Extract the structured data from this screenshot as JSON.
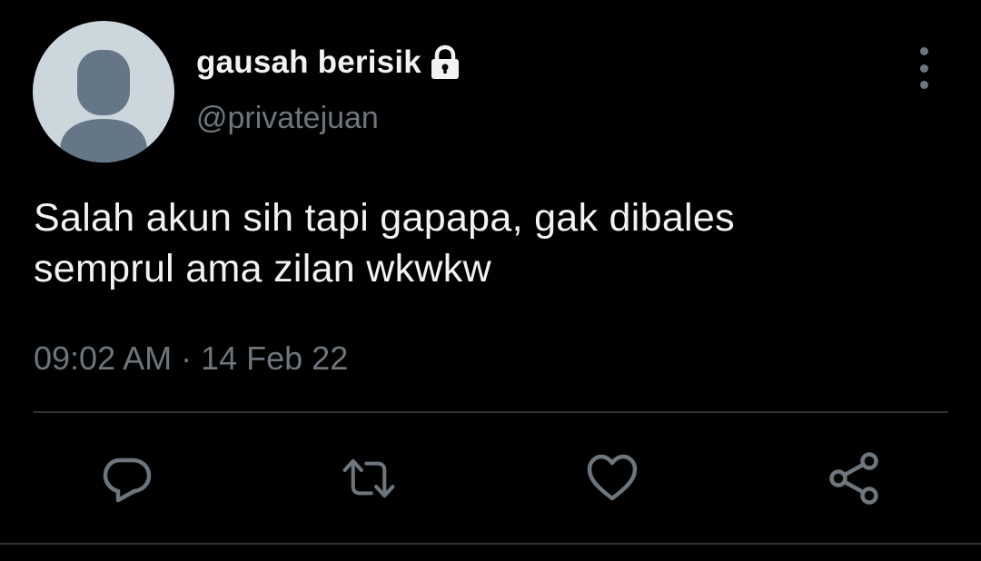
{
  "author": {
    "display_name": "gausah berisik",
    "handle": "@privatejuan",
    "protected_icon": "lock-icon",
    "avatar": "default-avatar-icon"
  },
  "tweet": {
    "text_lines": [
      "Salah akun sih tapi gapapa, gak dibales",
      "semprul ama zilan wkwkw"
    ],
    "timestamp": "09:02 AM · 14 Feb 22"
  },
  "actions": [
    {
      "name": "reply",
      "icon": "reply-icon"
    },
    {
      "name": "retweet",
      "icon": "retweet-icon"
    },
    {
      "name": "like",
      "icon": "heart-icon"
    },
    {
      "name": "share",
      "icon": "share-icon"
    }
  ],
  "more_menu_icon": "more-vertical-icon",
  "colors": {
    "background": "#000000",
    "primary_text": "#f2f2f2",
    "secondary_text": "#6e767d",
    "divider": "#2f3336",
    "avatar_bg": "#ccd6dd",
    "avatar_silhouette": "#657786"
  }
}
